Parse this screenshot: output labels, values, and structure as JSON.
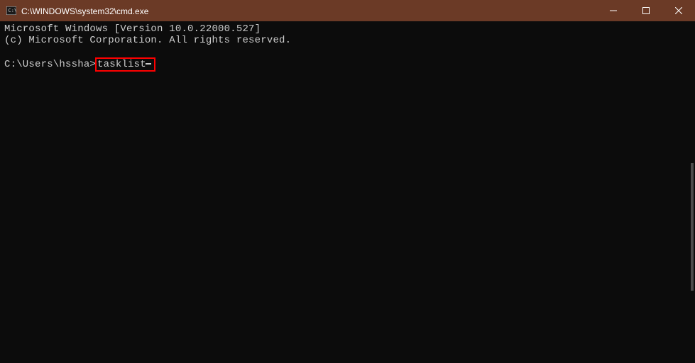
{
  "titlebar": {
    "title": "C:\\WINDOWS\\system32\\cmd.exe"
  },
  "terminal": {
    "version_line": "Microsoft Windows [Version 10.0.22000.527]",
    "copyright_line": "(c) Microsoft Corporation. All rights reserved.",
    "prompt": "C:\\Users\\hssha>",
    "command": "tasklist"
  }
}
